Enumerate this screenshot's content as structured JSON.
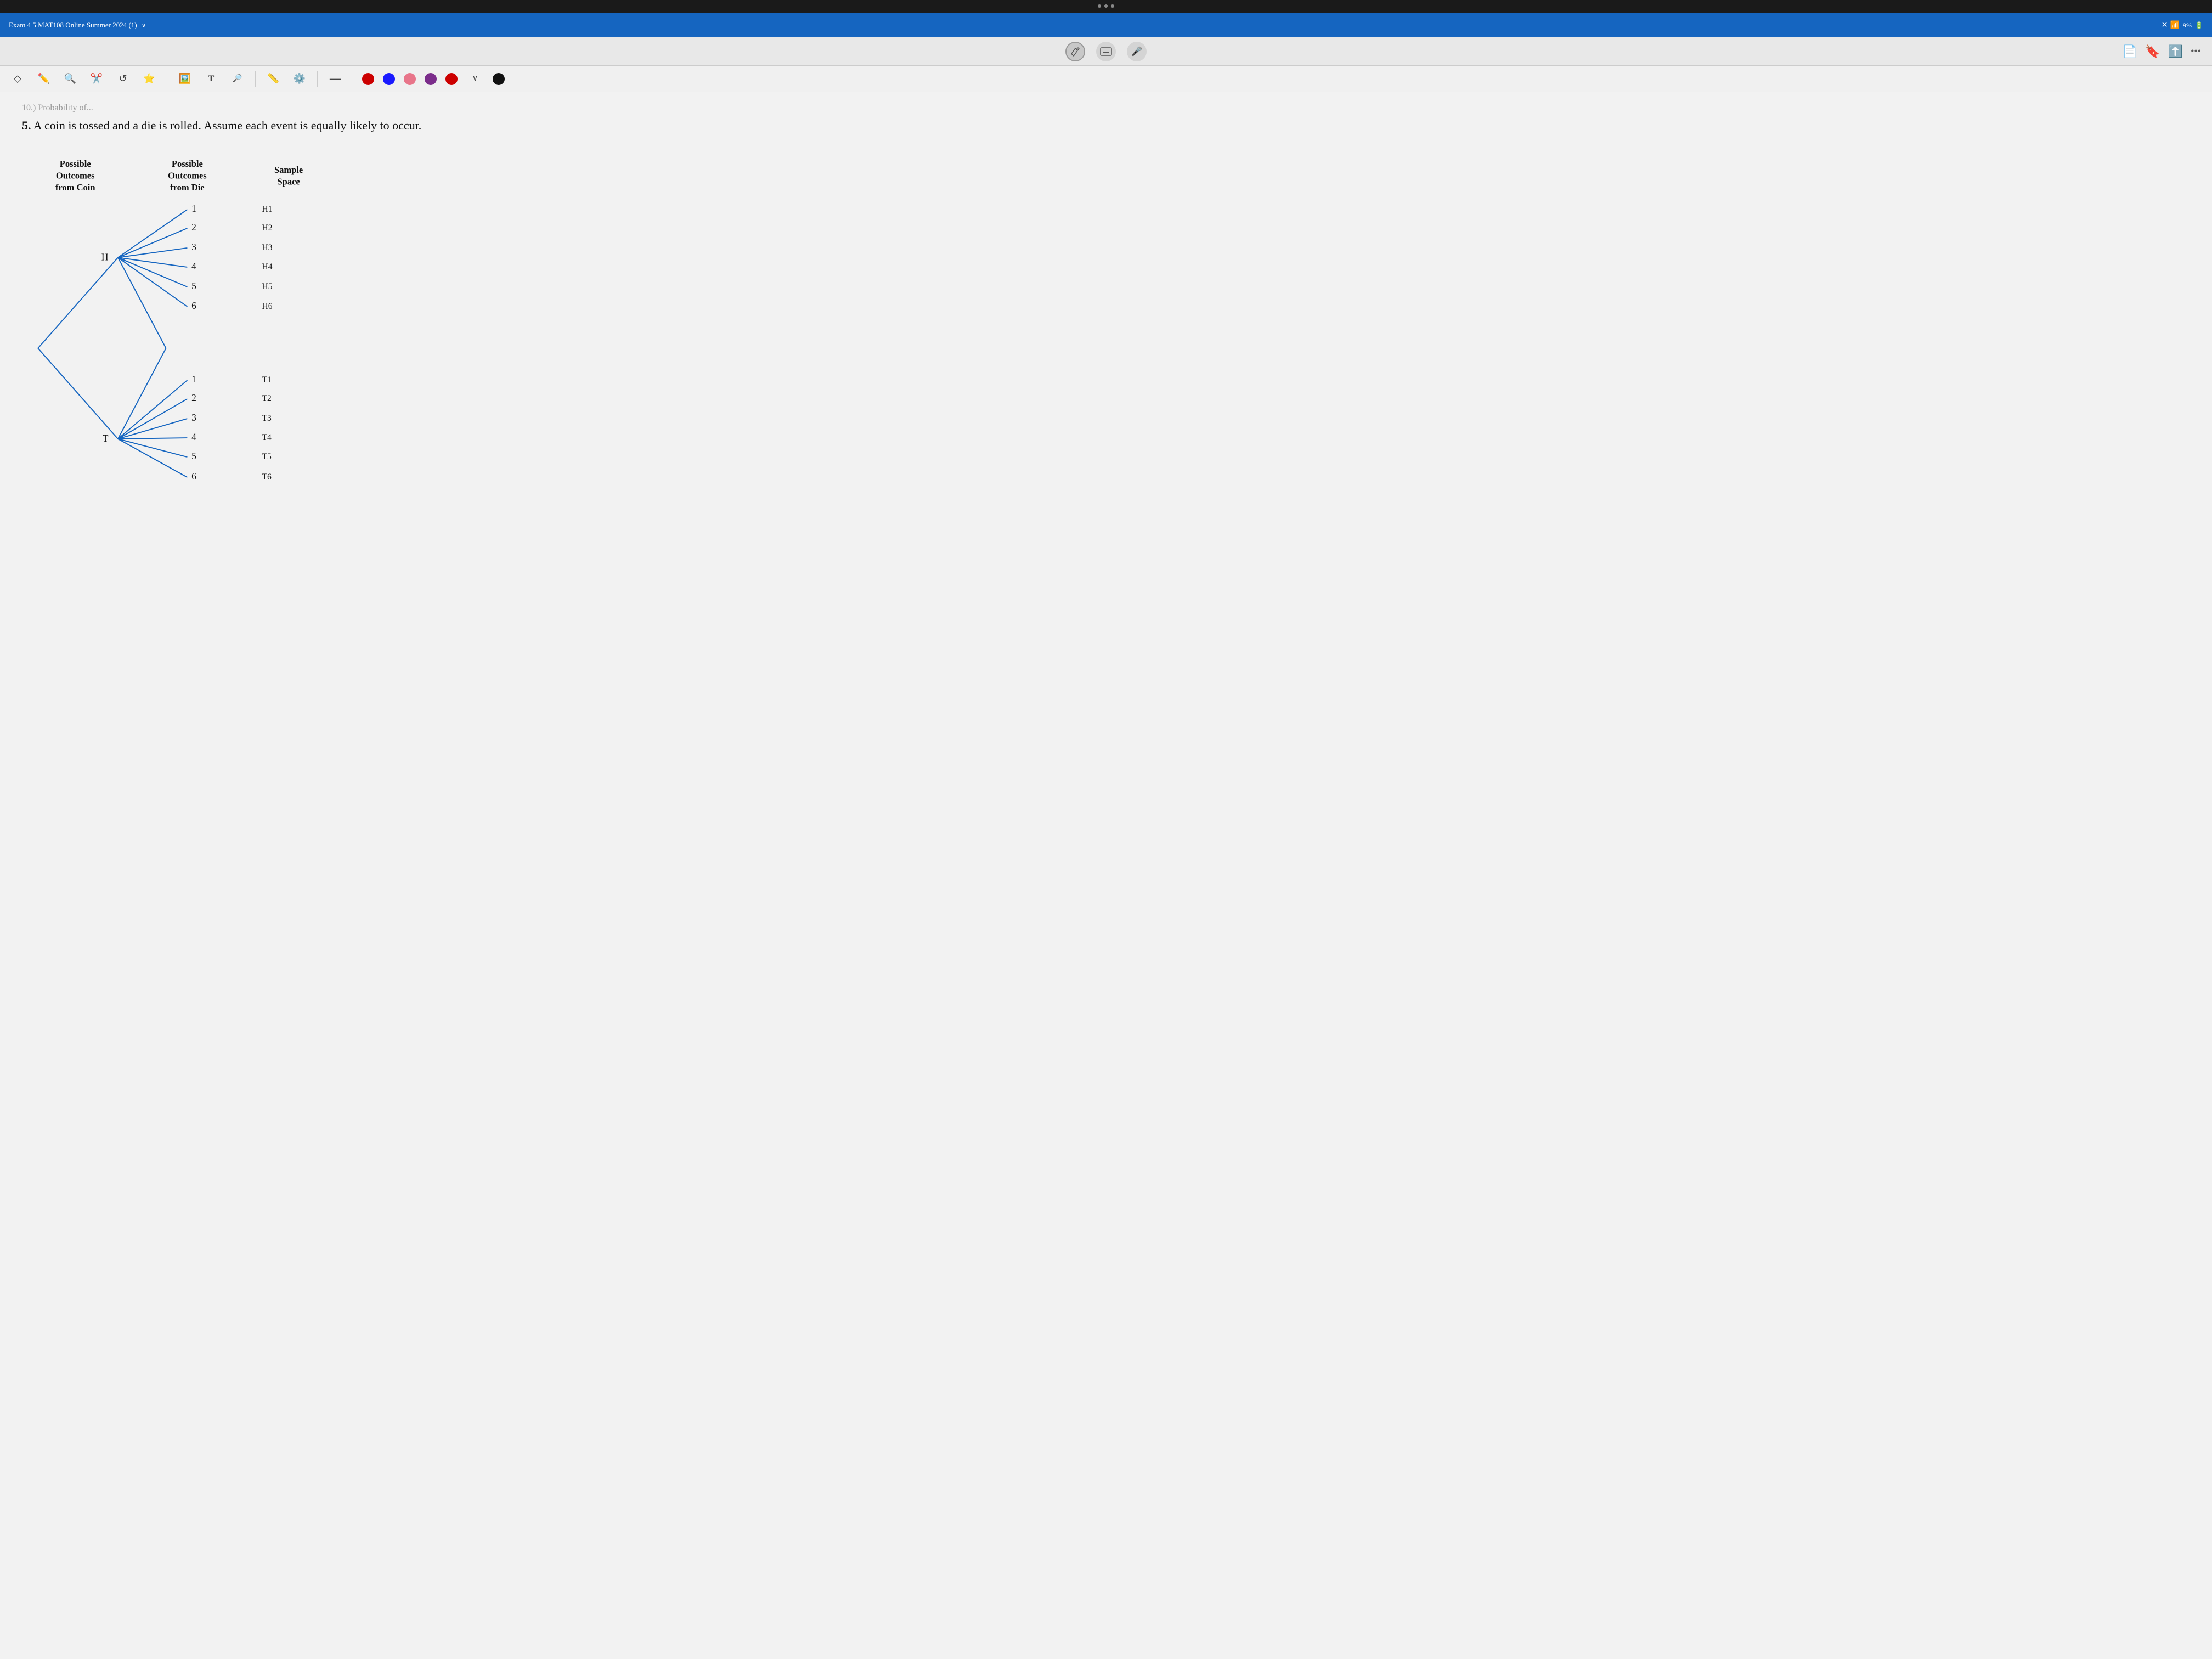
{
  "system": {
    "title": "Exam 4  5 MAT108 Online Summer 2024 (1)",
    "wifi": "9%",
    "battery_icon": "🔋"
  },
  "toolbar": {
    "center_icons": [
      "✏️",
      "✏️",
      "🔍",
      "✂️",
      "↺",
      "⭐",
      "🖼️",
      "T",
      "🔍",
      "✏️",
      "⚙️"
    ],
    "right_icons": [
      "📄",
      "🔖",
      "⬆️"
    ]
  },
  "annotation_colors": [
    "#cc0000",
    "#1a1aff",
    "#e8758a",
    "#7b2d8b",
    "#cc0000",
    "#111111"
  ],
  "problem": {
    "number": "5.",
    "text": "A coin is tossed and a die is rolled.  Assume each event is equally likely to occur.",
    "header_partial": "10.) Probability of..."
  },
  "diagram": {
    "col1_header": "Possible\nOutcomes\nfrom Coin",
    "col2_header": "Possible\nOutcomes\nfrom Die",
    "col3_header": "Sample\nSpace",
    "coin_outcomes": [
      "H",
      "T"
    ],
    "die_outcomes": [
      "1",
      "2",
      "3",
      "4",
      "5",
      "6"
    ],
    "sample_space_H": [
      "H1",
      "H2",
      "H3",
      "H4",
      "H5",
      "H6"
    ],
    "sample_space_T": [
      "T1",
      "T2",
      "T3",
      "T4",
      "T5",
      "T6"
    ]
  }
}
